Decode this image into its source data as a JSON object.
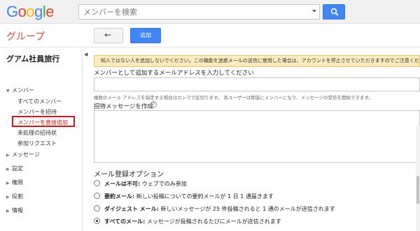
{
  "brand": {
    "letters": [
      "G",
      "o",
      "o",
      "g",
      "l",
      "e"
    ],
    "colors": [
      "#4285f4",
      "#ea4335",
      "#fbbc05",
      "#4285f4",
      "#34a853",
      "#ea4335"
    ]
  },
  "search": {
    "placeholder": "メンバーを検索"
  },
  "header": {
    "groups_title": "グループ",
    "back_label": "←",
    "add_label": "追加"
  },
  "sidebar": {
    "group_name": "グアム社員旅行",
    "collapse": "◀",
    "members_section": "メンバー",
    "member_items": [
      "すべてのメンバー",
      "メンバーを招待",
      "メンバーを直接追加",
      "未処理の招待状",
      "参加リクエスト"
    ],
    "sections": [
      "メッセージ",
      "設定",
      "権限",
      "役割",
      "情報"
    ]
  },
  "main": {
    "notice": "知人ではない人を追加しないでください。この機能を迷惑メールの送信に使用した場合は、アカウントを停止させていただきますのでご注意ください。",
    "email_label": "メンバーとして追加するメールアドレスを入力してください",
    "email_helper": "複数のメール アドレスを指定する場合はカンマで区切ります。 各ユーザーは即座にメンバーになり、メッセージの受信を開始できます。",
    "invite_label": "招待メッセージを作成",
    "help_glyph": "?",
    "options_title": "メール登録オプション",
    "options": [
      {
        "bold": "メールは不可:",
        "text": " ウェブでのみ参加",
        "checked": false
      },
      {
        "bold": "要約メール:",
        "text": " 新しい投稿についての要約メールが 1 日 1 通届きます",
        "checked": false
      },
      {
        "bold": "ダイジェスト メール:",
        "text": " 新しいメッセージが 25 件投稿されると 1 通のメールが送信されます",
        "checked": false
      },
      {
        "bold": "すべてのメール:",
        "text": " メッセージが投稿されるたびにメールが送信されます",
        "checked": true
      }
    ]
  },
  "colors": {
    "accent": "#4285f4",
    "groups_title": "#dd4b39",
    "highlight": "#d21919",
    "notice_bg": "#f9edbe"
  }
}
